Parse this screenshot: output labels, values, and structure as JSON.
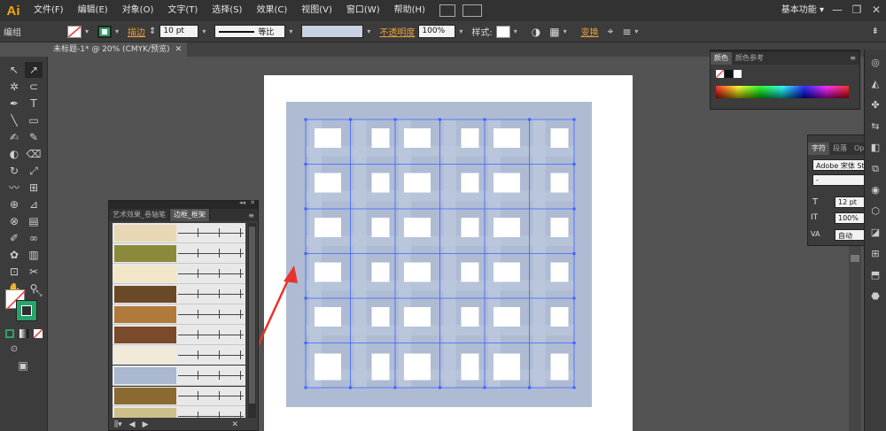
{
  "menubar": {
    "logo": "Ai",
    "items": [
      "文件(F)",
      "编辑(E)",
      "对象(O)",
      "文字(T)",
      "选择(S)",
      "效果(C)",
      "视图(V)",
      "窗口(W)",
      "帮助(H)"
    ],
    "workspace": "基本功能",
    "workspace_caret": "▾",
    "minimize": "—",
    "restore": "❐",
    "close": "✕"
  },
  "controlbar": {
    "group_label": "编组",
    "stroke_label": "描边",
    "stroke_width": "10 pt",
    "stroke_profile": "等比",
    "opacity_label": "不透明度",
    "opacity_value": "100%",
    "style_label": "样式:",
    "transform_label": "变换",
    "caret": "▾",
    "spin": "⇕",
    "globe_icon": "◑",
    "grid_icon": "▦",
    "align_icon": "⌖",
    "more_icon": "≡",
    "expand_icon": "⇟",
    "menu_icon": "≡"
  },
  "document_tab": {
    "title": "未标题-1* @ 20% (CMYK/预览)",
    "close": "✕"
  },
  "tools": {
    "selection": "↖",
    "direct_selection": "↗",
    "magic_wand": "✲",
    "lasso": "⊂",
    "pen": "✒",
    "type": "T",
    "line": "╲",
    "rectangle": "▭",
    "paintbrush": "✍",
    "pencil": "✎",
    "blob_brush": "◐",
    "eraser": "⌫",
    "rotate": "↻",
    "scale": "⤢",
    "warp": "〰",
    "free_transform": "⊞",
    "shape_builder": "⊕",
    "perspective": "⊿",
    "mesh": "⊗",
    "gradient": "▤",
    "eyedropper": "✐",
    "blend": "∞",
    "symbol_sprayer": "✿",
    "column_graph": "▥",
    "artboard": "⊡",
    "slice": "✂",
    "hand": "✋",
    "zoom": "⚲",
    "swap": "⤡",
    "draw_normal": "⊙",
    "screen_mode": "▣"
  },
  "brush_panel": {
    "tabs": [
      "艺术效果_卷轴笔",
      "边框_框架"
    ],
    "active_tab": 1,
    "collapse": "◂◂",
    "close": "✕",
    "menu": "≡",
    "footer": {
      "library": "⫼▾",
      "prev": "◀",
      "next": "▶",
      "tools": "✕"
    },
    "rows": [
      {
        "cap": "#e8d7b4"
      },
      {
        "cap": "#8b8a3c"
      },
      {
        "cap": "#f1e6c8"
      },
      {
        "cap": "#6a4a26"
      },
      {
        "cap": "#b07a3c"
      },
      {
        "cap": "#7a4a2a"
      },
      {
        "cap": "#f2ead8"
      },
      {
        "cap": "#aab8d0"
      },
      {
        "cap": "#8a6a30"
      },
      {
        "cap": "#cdbf8a"
      }
    ]
  },
  "color_panel": {
    "tabs": [
      "颜色",
      "颜色参考"
    ],
    "collapse": "◂◂",
    "close": "✕",
    "menu": "≡"
  },
  "char_panel": {
    "tabs": [
      "字符",
      "段落",
      "Ope"
    ],
    "font_family": "Adobe 宋体 Std L",
    "font_style": "-",
    "font_size": "12 pt",
    "leading": "100%",
    "tracking_mode": "自动",
    "size_icon": "T",
    "leading_icon": "IT",
    "tracking_icon": "VA"
  },
  "dock": {
    "icons": [
      "◎",
      "◭",
      "✤",
      "⇆",
      "◧",
      "⧉",
      "◉",
      "⬡",
      "◪",
      "⊞",
      "⬒",
      "⬣"
    ]
  },
  "colors": {
    "pattern_fill": "#aebbd3",
    "pattern_band": "#b9c6dc",
    "selection": "#3b64ff",
    "arrow": "#e8332a",
    "accent_orange": "#f7a50b"
  }
}
